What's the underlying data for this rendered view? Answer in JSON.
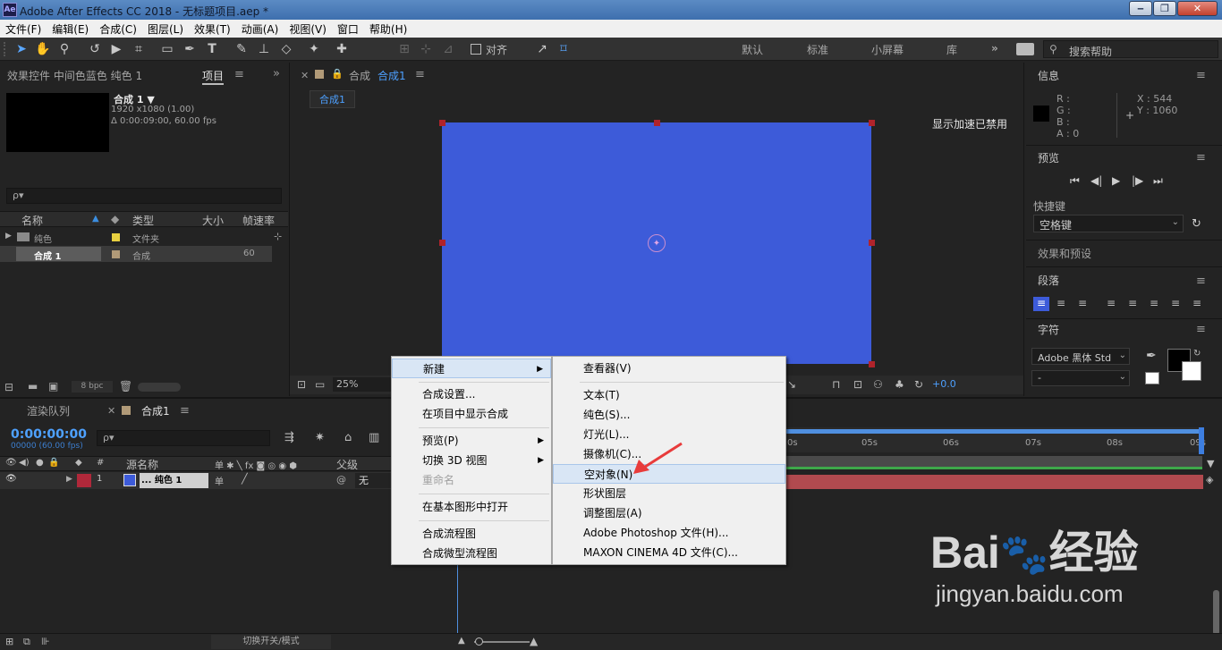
{
  "window": {
    "title": "Adobe After Effects CC 2018 - 无标题项目.aep *",
    "logo": "Ae"
  },
  "menubar": [
    "文件(F)",
    "编辑(E)",
    "合成(C)",
    "图层(L)",
    "效果(T)",
    "动画(A)",
    "视图(V)",
    "窗口",
    "帮助(H)"
  ],
  "toolbar": {
    "snap_label": "对齐",
    "workspaces": [
      "默认",
      "标准",
      "小屏幕",
      "库"
    ],
    "search_placeholder": "搜索帮助"
  },
  "project_panel": {
    "tab_effects": "效果控件 中间色蓝色 纯色 1",
    "tab_project": "项目",
    "comp_name": "合成 1 ▼",
    "comp_res": "1920 x1080 (1.00)",
    "comp_dur": "Δ 0:00:09:00, 60.00 fps",
    "search_placeholder": "ρ▾",
    "columns": [
      "名称",
      "类型",
      "大小",
      "帧速率"
    ],
    "rows": [
      {
        "name": "纯色",
        "type": "文件夹",
        "fps": "",
        "color": "#e8d040"
      },
      {
        "name": "合成 1",
        "type": "合成",
        "fps": "60",
        "color": "#b19a78"
      }
    ],
    "bpc": "8 bpc"
  },
  "viewer": {
    "tab_label": "合成",
    "tab_comp": "合成1",
    "breadcrumb": "合成1",
    "accel_notice": "显示加速已禁用",
    "zoom": "25%",
    "exposure": "+0.0",
    "canvas_color": "#3d5bd9"
  },
  "right_panel": {
    "info": "信息",
    "r": "R :",
    "g": "G :",
    "b": "B :",
    "a": "A : 0",
    "x": "X : 544",
    "y": "Y : 1060",
    "preview": "预览",
    "shortcut": "快捷键",
    "shortcut_value": "空格键",
    "effects": "效果和预设",
    "paragraph": "段落",
    "character": "字符",
    "font": "Adobe 黑体 Std",
    "font_style": "-"
  },
  "timeline": {
    "tab_render": "渲染队列",
    "tab_comp": "合成1",
    "timecode": "0:00:00:00",
    "timecode_sub": "00000 (60.00 fps)",
    "search_placeholder": "ρ▾",
    "col_source": "源名称",
    "col_parent": "父级",
    "layer_num": "1",
    "layer_name": "... 纯色 1",
    "parent_value": "无",
    "ruler": [
      "0s",
      "05s",
      "06s",
      "07s",
      "08s",
      "09s"
    ],
    "toggle_mode": "切换开关/模式",
    "layer_color": "#b14a4f"
  },
  "context_menu": {
    "items": [
      {
        "label": "新建",
        "submenu": true
      },
      {
        "label": "合成设置..."
      },
      {
        "label": "在项目中显示合成"
      },
      {
        "label": "预览(P)",
        "submenu": true
      },
      {
        "label": "切换 3D 视图",
        "submenu": true
      },
      {
        "label": "重命名",
        "disabled": true
      },
      {
        "label": "在基本图形中打开"
      },
      {
        "label": "合成流程图"
      },
      {
        "label": "合成微型流程图"
      }
    ]
  },
  "submenu": {
    "items": [
      "查看器(V)",
      "文本(T)",
      "纯色(S)...",
      "灯光(L)...",
      "摄像机(C)...",
      "空对象(N)",
      "形状图层",
      "调整图层(A)",
      "Adobe Photoshop 文件(H)...",
      "MAXON CINEMA 4D 文件(C)..."
    ]
  },
  "watermark": {
    "brand": "Bai",
    "brand2": "经验",
    "url": "jingyan.baidu.com"
  }
}
